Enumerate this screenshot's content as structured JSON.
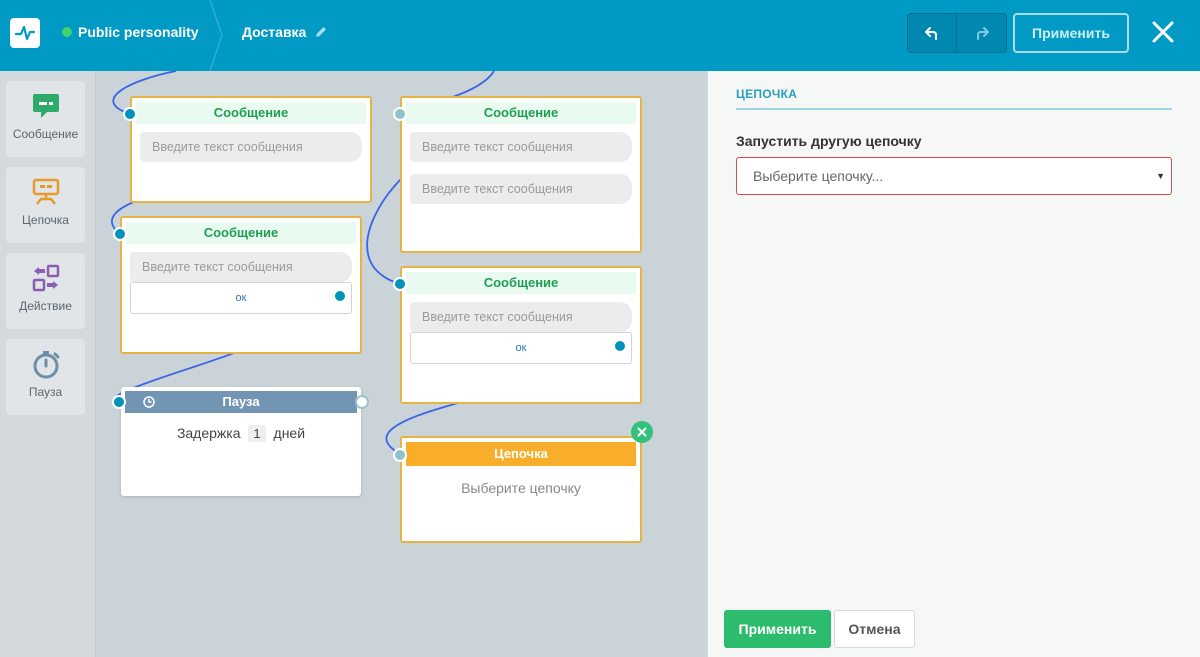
{
  "header": {
    "bot_name": "Public personality",
    "flow_name": "Доставка",
    "apply_label": "Применить",
    "accent": "#009ac4",
    "status_color": "#41d36f"
  },
  "toolbox": {
    "items": [
      {
        "label": "Сообщение",
        "icon": "message-icon"
      },
      {
        "label": "Цепочка",
        "icon": "chain-icon"
      },
      {
        "label": "Действие",
        "icon": "action-icon"
      },
      {
        "label": "Пауза",
        "icon": "timer-icon"
      }
    ]
  },
  "canvas": {
    "msg1": {
      "title": "Сообщение",
      "bubbles": [
        "Введите текст сообщения"
      ]
    },
    "msg2": {
      "title": "Сообщение",
      "bubbles": [
        "Введите текст сообщения"
      ],
      "button": "ок"
    },
    "msg3": {
      "title": "Сообщение",
      "bubbles": [
        "Введите текст сообщения",
        "Введите текст сообщения"
      ]
    },
    "msg4": {
      "title": "Сообщение",
      "bubbles": [
        "Введите текст сообщения"
      ],
      "button": "ок"
    },
    "pause": {
      "title": "Пауза",
      "prefix": "Задержка",
      "value": "1",
      "unit": "дней"
    },
    "chain": {
      "title": "Цепочка",
      "placeholder": "Выберите цепочку"
    }
  },
  "panel": {
    "title": "ЦЕПОЧКА",
    "field_label": "Запустить другую цепочку",
    "select_placeholder": "Выберите цепочку...",
    "apply_label": "Применить",
    "cancel_label": "Отмена"
  }
}
